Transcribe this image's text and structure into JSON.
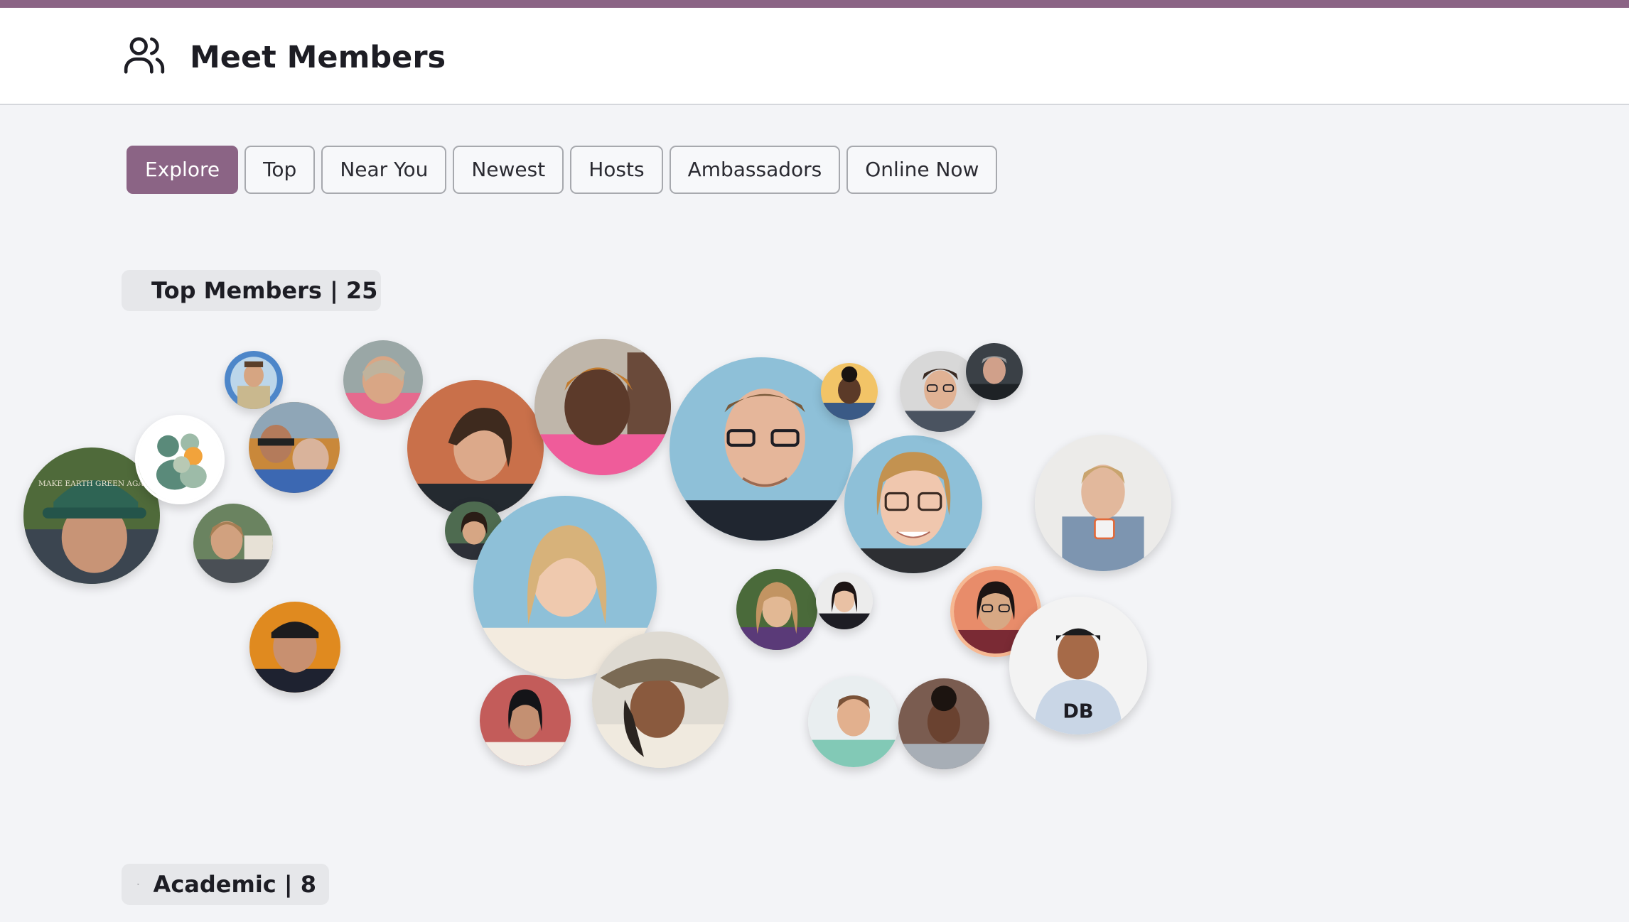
{
  "header": {
    "title": "Meet Members",
    "icon": "people-icon"
  },
  "tabs": [
    {
      "label": "Explore",
      "active": true
    },
    {
      "label": "Top",
      "active": false
    },
    {
      "label": "Near You",
      "active": false
    },
    {
      "label": "Newest",
      "active": false
    },
    {
      "label": "Hosts",
      "active": false
    },
    {
      "label": "Ambassadors",
      "active": false
    },
    {
      "label": "Online Now",
      "active": false
    }
  ],
  "sections": {
    "top_members": {
      "label": "Top Members | 25",
      "icon": "sparkle-icon"
    },
    "academic": {
      "label": "Academic | 8",
      "icon": "sparkle-icon"
    }
  },
  "avatar_cap_text": "MAKE EARTH GREEN AGAIN",
  "colors": {
    "accent": "#8b6485",
    "page_bg": "#f3f4f7",
    "header_bg": "#ffffff"
  }
}
